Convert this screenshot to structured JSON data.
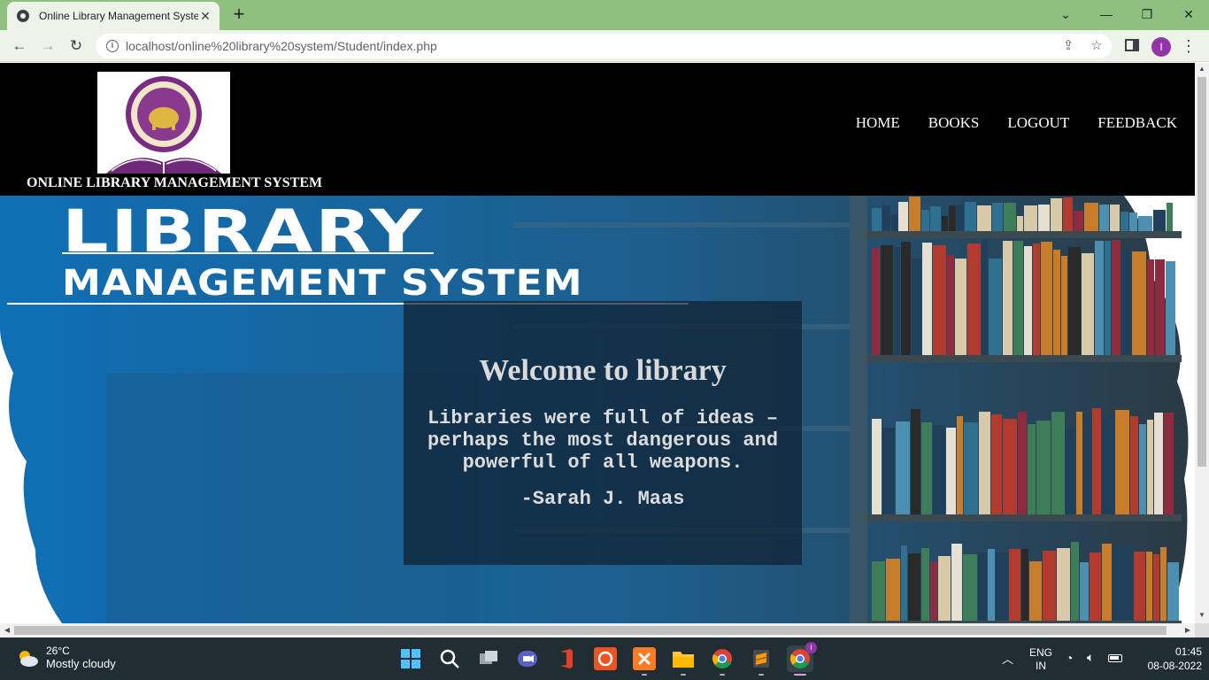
{
  "browser": {
    "tab_title": "Online Library Management System",
    "tab_close": "✕",
    "new_tab": "+",
    "url": "localhost/online%20library%20system/Student/index.php",
    "profile_initial": "I"
  },
  "site": {
    "title": "ONLINE LIBRARY MANAGEMENT SYSTEM",
    "nav": [
      "HOME",
      "BOOKS",
      "LOGOUT",
      "FEEDBACK"
    ]
  },
  "hero": {
    "banner_line1": "LIBRARY",
    "banner_line2": "MANAGEMENT SYSTEM",
    "welcome": "Welcome to library",
    "quote": "Libraries were full of ideas – perhaps the most dangerous and powerful of all weapons.",
    "author": "-Sarah J. Maas"
  },
  "taskbar": {
    "temperature": "26°C",
    "weather": "Mostly cloudy",
    "language": "ENG",
    "region": "IN",
    "time": "01:45",
    "date": "08-08-2022",
    "chrome_badge": "I"
  },
  "colors": {
    "tab_strip": "#8fc07f",
    "toolbar": "#eef3ea",
    "header_bg": "#000000",
    "taskbar_bg": "#202e33",
    "hero_blue": "#1a6fa8"
  }
}
